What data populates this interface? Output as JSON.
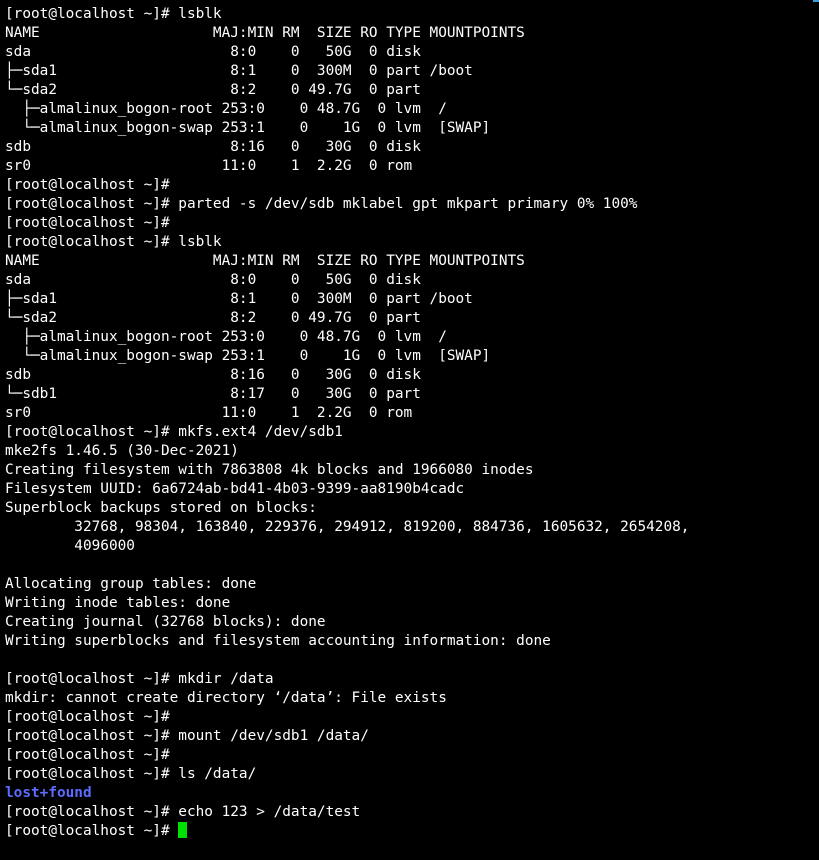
{
  "terminal": {
    "lines": [
      {
        "text": "[root@localhost ~]# lsblk"
      },
      {
        "text": "NAME                    MAJ:MIN RM  SIZE RO TYPE MOUNTPOINTS"
      },
      {
        "text": "sda                       8:0    0   50G  0 disk"
      },
      {
        "text": "├─sda1                    8:1    0  300M  0 part /boot"
      },
      {
        "text": "└─sda2                    8:2    0 49.7G  0 part"
      },
      {
        "text": "  ├─almalinux_bogon-root 253:0    0 48.7G  0 lvm  /"
      },
      {
        "text": "  └─almalinux_bogon-swap 253:1    0    1G  0 lvm  [SWAP]"
      },
      {
        "text": "sdb                       8:16   0   30G  0 disk"
      },
      {
        "text": "sr0                      11:0    1  2.2G  0 rom"
      },
      {
        "text": "[root@localhost ~]#"
      },
      {
        "text": "[root@localhost ~]# parted -s /dev/sdb mklabel gpt mkpart primary 0% 100%"
      },
      {
        "text": "[root@localhost ~]#"
      },
      {
        "text": "[root@localhost ~]# lsblk"
      },
      {
        "text": "NAME                    MAJ:MIN RM  SIZE RO TYPE MOUNTPOINTS"
      },
      {
        "text": "sda                       8:0    0   50G  0 disk"
      },
      {
        "text": "├─sda1                    8:1    0  300M  0 part /boot"
      },
      {
        "text": "└─sda2                    8:2    0 49.7G  0 part"
      },
      {
        "text": "  ├─almalinux_bogon-root 253:0    0 48.7G  0 lvm  /"
      },
      {
        "text": "  └─almalinux_bogon-swap 253:1    0    1G  0 lvm  [SWAP]"
      },
      {
        "text": "sdb                       8:16   0   30G  0 disk"
      },
      {
        "text": "└─sdb1                    8:17   0   30G  0 part"
      },
      {
        "text": "sr0                      11:0    1  2.2G  0 rom"
      },
      {
        "text": "[root@localhost ~]# mkfs.ext4 /dev/sdb1"
      },
      {
        "text": "mke2fs 1.46.5 (30-Dec-2021)"
      },
      {
        "text": "Creating filesystem with 7863808 4k blocks and 1966080 inodes"
      },
      {
        "text": "Filesystem UUID: 6a6724ab-bd41-4b03-9399-aa8190b4cadc"
      },
      {
        "text": "Superblock backups stored on blocks:"
      },
      {
        "text": "        32768, 98304, 163840, 229376, 294912, 819200, 884736, 1605632, 2654208,"
      },
      {
        "text": "        4096000"
      },
      {
        "text": ""
      },
      {
        "text": "Allocating group tables: done"
      },
      {
        "text": "Writing inode tables: done"
      },
      {
        "text": "Creating journal (32768 blocks): done"
      },
      {
        "text": "Writing superblocks and filesystem accounting information: done"
      },
      {
        "text": ""
      },
      {
        "text": "[root@localhost ~]# mkdir /data"
      },
      {
        "text": "mkdir: cannot create directory ‘/data’: File exists"
      },
      {
        "text": "[root@localhost ~]#"
      },
      {
        "text": "[root@localhost ~]# mount /dev/sdb1 /data/"
      },
      {
        "text": "[root@localhost ~]#"
      },
      {
        "text": "[root@localhost ~]# ls /data/"
      },
      {
        "text": "lost+found",
        "kind": "dir"
      },
      {
        "text": "[root@localhost ~]# echo 123 > /data/test"
      }
    ],
    "prompt": "[root@localhost ~]# ",
    "colors": {
      "background": "#000000",
      "foreground": "#ffffff",
      "directory": "#5c6cff",
      "cursor": "#00e000"
    }
  }
}
